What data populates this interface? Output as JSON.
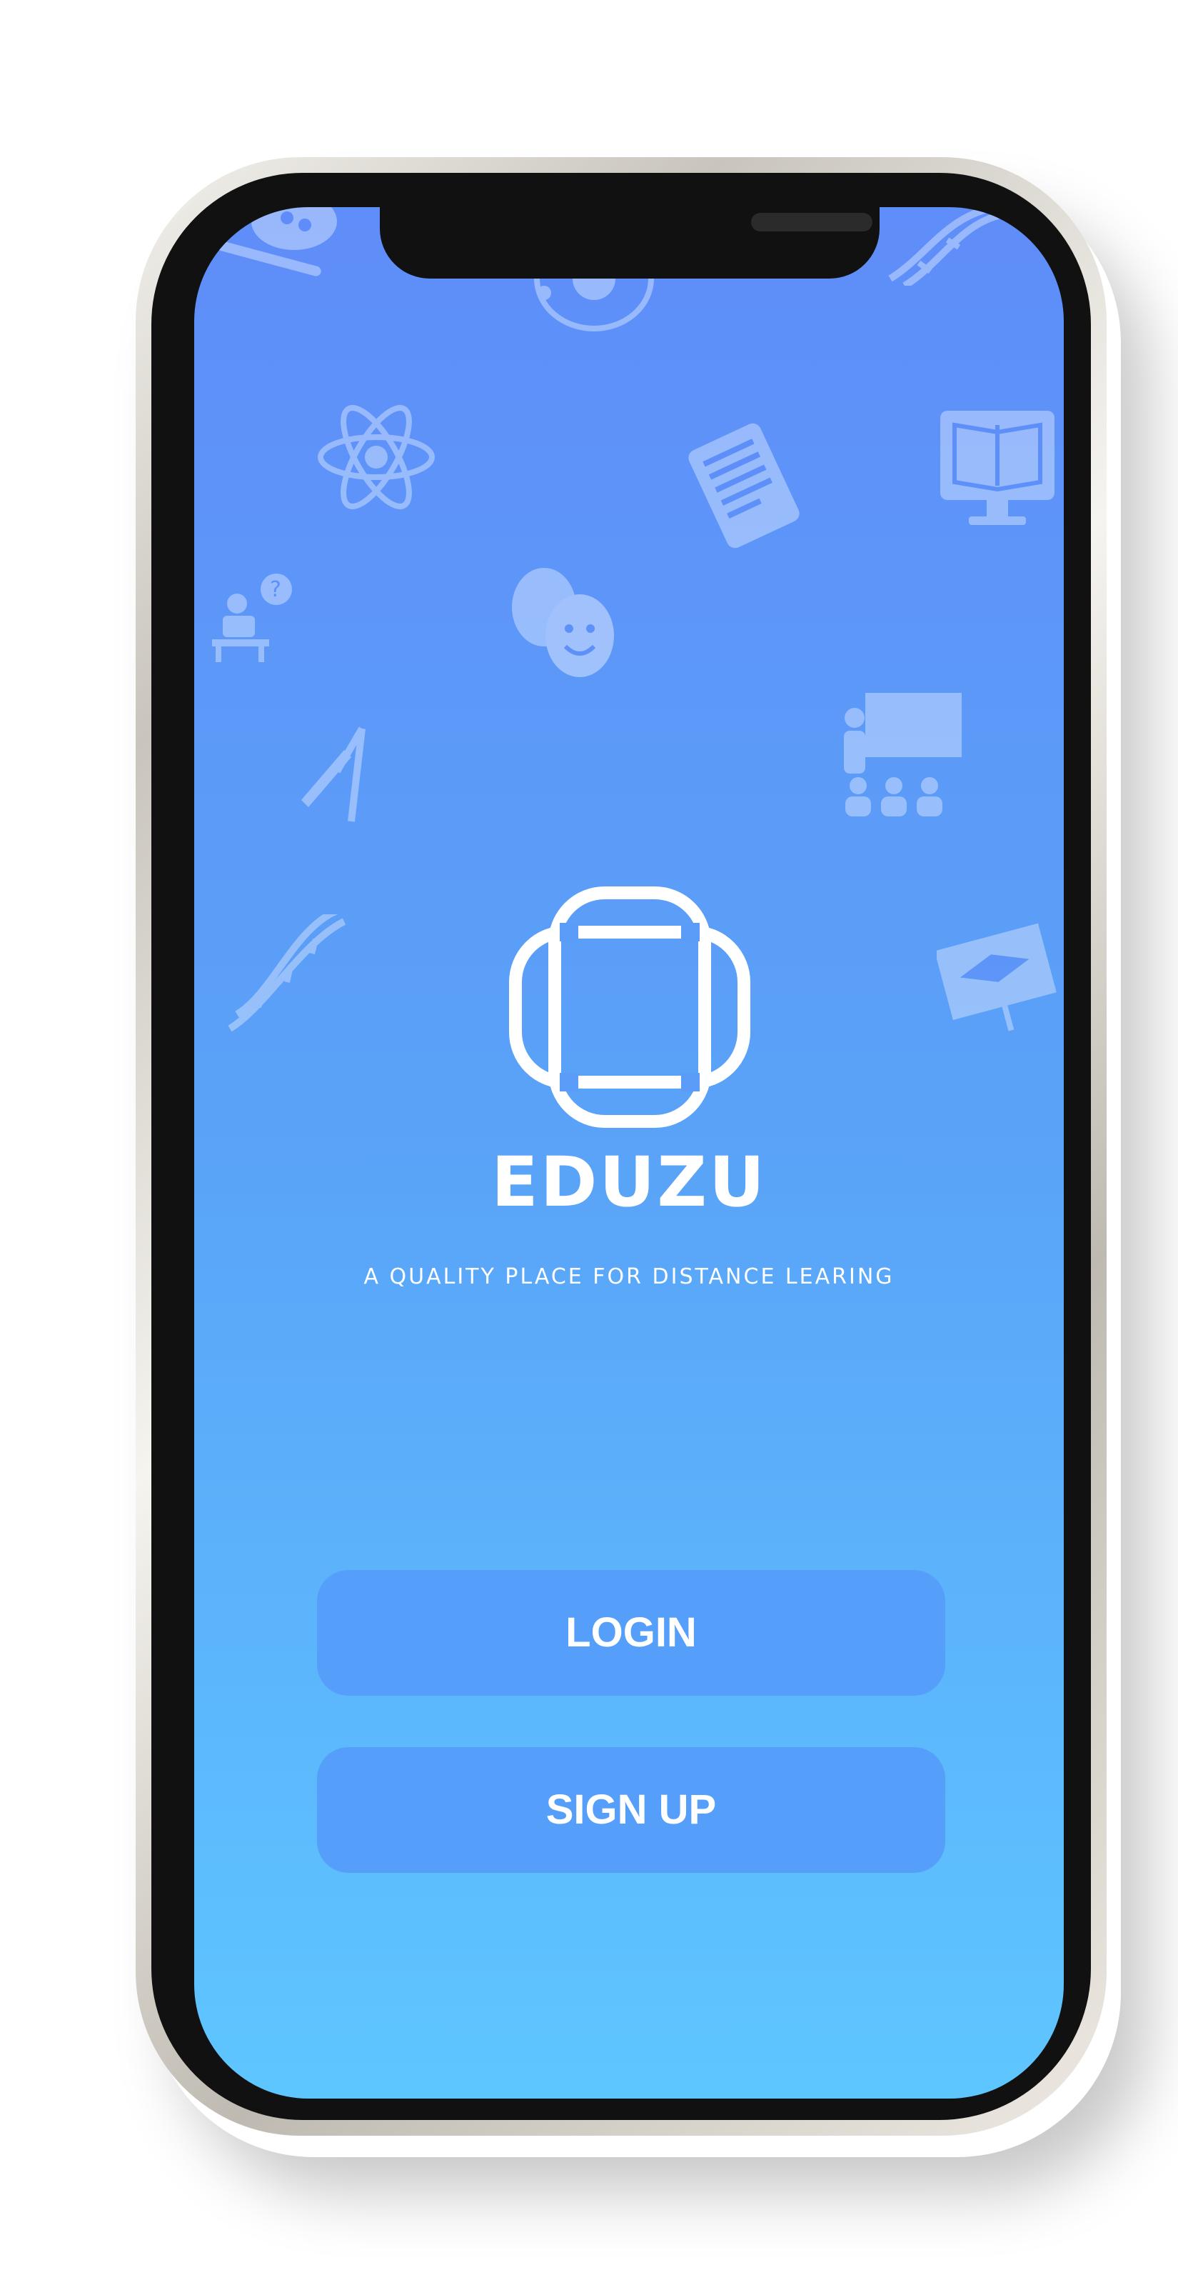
{
  "app": {
    "brand": "EDUZU",
    "tagline": "A QUALITY PLACE FOR DISTANCE LEARING"
  },
  "actions": {
    "login_label": "LOGIN",
    "signup_label": "SIGN UP"
  },
  "background_icons": [
    "palette-icon",
    "solar-system-icon",
    "dna-icon",
    "atom-icon",
    "tablet-book-icon",
    "computer-book-icon",
    "classroom-question-icon",
    "theater-masks-icon",
    "drawing-tools-icon",
    "teacher-board-icon",
    "dna-strand-icon",
    "graduation-board-icon"
  ],
  "colors": {
    "gradient_top": "#5f8df9",
    "gradient_bottom": "#5ec6ff",
    "button": "#559ffb",
    "text": "#ffffff"
  }
}
